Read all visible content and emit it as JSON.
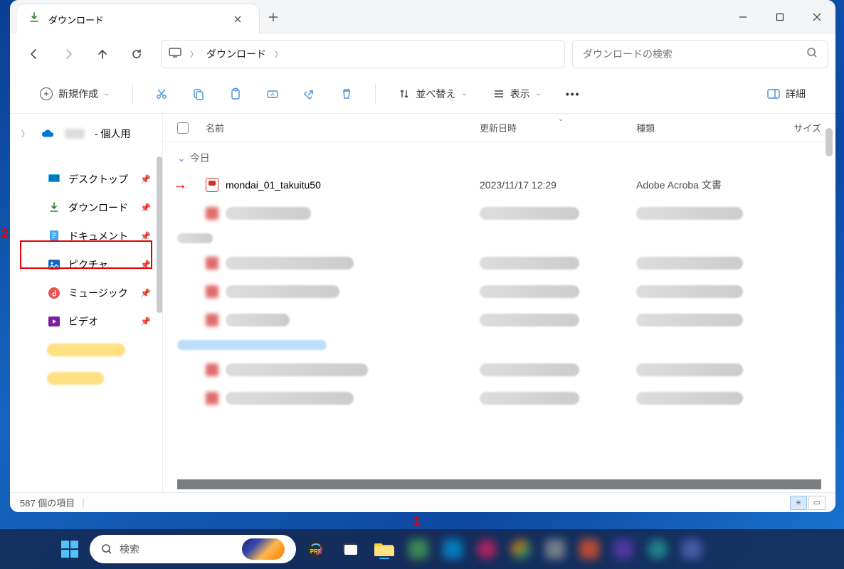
{
  "tab": {
    "title": "ダウンロード"
  },
  "breadcrumb": {
    "segments": [
      "ダウンロード"
    ]
  },
  "search": {
    "placeholder": "ダウンロードの検索"
  },
  "toolbar": {
    "new": "新規作成",
    "sort": "並べ替え",
    "view": "表示",
    "detail": "詳細"
  },
  "nav": {
    "personal": "- 個人用",
    "items": [
      {
        "label": "デスクトップ",
        "icon": "desktop"
      },
      {
        "label": "ダウンロード",
        "icon": "download",
        "active": true
      },
      {
        "label": "ドキュメント",
        "icon": "document"
      },
      {
        "label": "ピクチャ",
        "icon": "picture"
      },
      {
        "label": "ミュージック",
        "icon": "music"
      },
      {
        "label": "ビデオ",
        "icon": "video"
      }
    ]
  },
  "columns": {
    "name": "名前",
    "date": "更新日時",
    "type": "種類",
    "size": "サイズ"
  },
  "groups": {
    "today": "今日"
  },
  "files": [
    {
      "name": "mondai_01_takuitu50",
      "date": "2023/11/17 12:29",
      "type": "Adobe Acroba 文書"
    }
  ],
  "status": {
    "count": "587 個の項目"
  },
  "taskbar": {
    "search": "検索"
  },
  "annotations": {
    "n1": "1",
    "n2": "2"
  }
}
